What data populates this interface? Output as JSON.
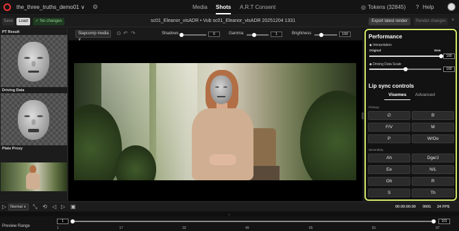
{
  "topbar": {
    "project": "the_three_truths_demo01 ∨",
    "tabs": [
      {
        "label": "Media"
      },
      {
        "label": "Shots"
      },
      {
        "label": "A.R.T Consent"
      }
    ],
    "tokens": "Tokens (32845)",
    "help": "Help"
  },
  "toolbar": {
    "save": "Save",
    "load": "Load",
    "no_changes": "✓ No changes",
    "shot_title": "sc01_Eleanor_visADR • Vub sc01_Eleanor_visADR 20251204 1331",
    "export": "Export latest render",
    "render": "Render changes",
    "close": "×"
  },
  "left_panel": {
    "sections": [
      {
        "label": "PT Result"
      },
      {
        "label": "Driving Data"
      },
      {
        "label": "Plate Proxy"
      }
    ]
  },
  "video_tools": {
    "mode_select": "Slapcomp media ∨",
    "sliders": [
      {
        "label": "Shadows",
        "value": "0",
        "level": 0.0
      },
      {
        "label": "Gamma",
        "value": "1",
        "level": 0.35
      },
      {
        "label": "Brightness",
        "value": "100",
        "level": 0.3
      }
    ]
  },
  "right_panel": {
    "performance_title": "Performance",
    "interpolation_label": "Interpolation",
    "interpolation_min": "Original",
    "interpolation_max": "New",
    "interpolation_value": "100",
    "interpolation_level": 1.0,
    "driving_scale_label": "Driving Data Scale",
    "driving_scale_value": "100",
    "driving_scale_level": 0.5,
    "lipsync_title": "Lip sync controls",
    "tabs": [
      {
        "label": "Visemes"
      },
      {
        "label": "Advanced"
      }
    ],
    "primary_label": "Primary",
    "primary": [
      {
        "label": "∅"
      },
      {
        "label": "B"
      },
      {
        "label": "F/V"
      },
      {
        "label": "M"
      },
      {
        "label": "P"
      },
      {
        "label": "W/Oo"
      }
    ],
    "secondary_label": "Secondary",
    "secondary": [
      {
        "label": "Ah"
      },
      {
        "label": "Dge/J"
      },
      {
        "label": "Ee"
      },
      {
        "label": "N/L"
      },
      {
        "label": "Oh"
      },
      {
        "label": "R"
      },
      {
        "label": "S"
      },
      {
        "label": "Th"
      }
    ]
  },
  "transport": {
    "speed": "Normal ∨",
    "timecode": "00:00:00:00",
    "frame": "0001",
    "fps": "24 FPS"
  },
  "timeline": {
    "label": "Preview Range",
    "start": "1",
    "end": "101",
    "ticks": [
      "1",
      "17",
      "33",
      "49",
      "65",
      "81",
      "97"
    ]
  },
  "colors": {
    "accent": "#d7e96b",
    "logo": "#e33333",
    "status_ok": "#8fd08f"
  }
}
